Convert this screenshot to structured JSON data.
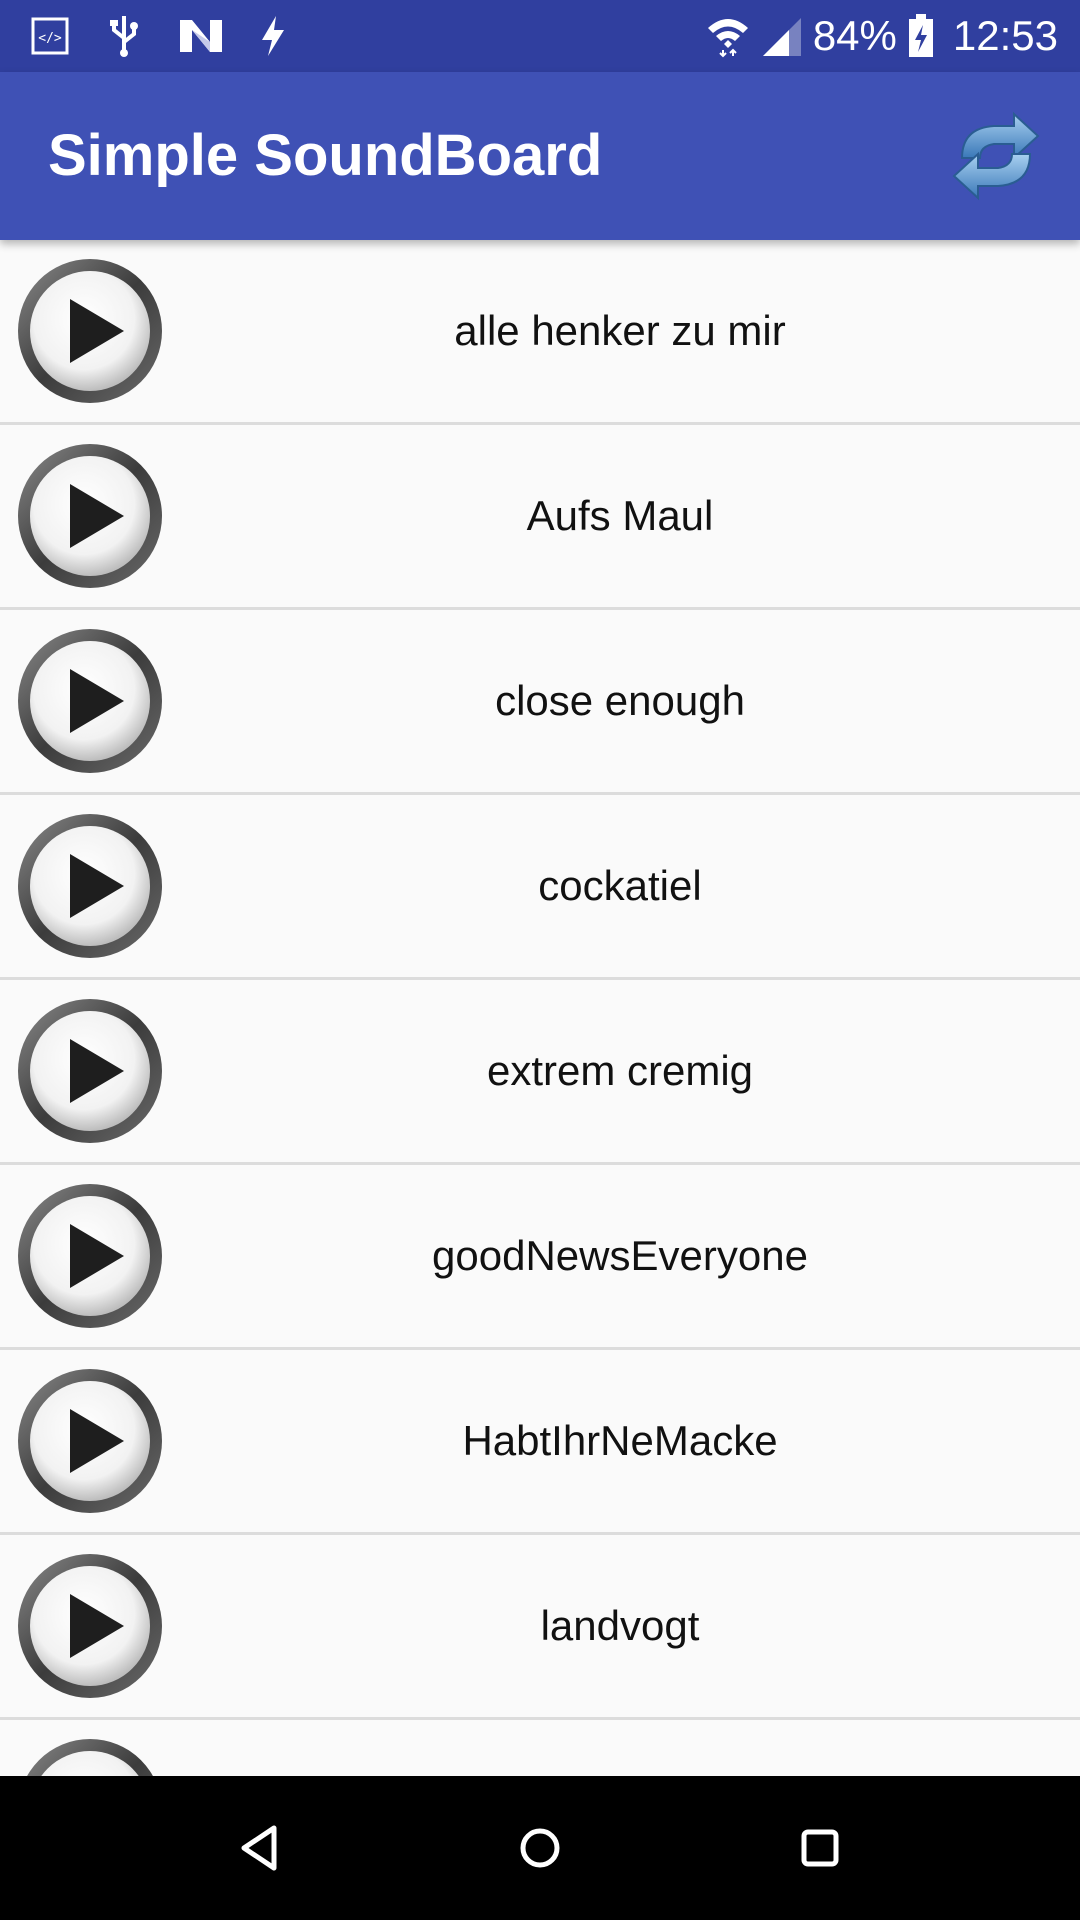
{
  "status_bar": {
    "battery_percent": "84%",
    "time": "12:53",
    "icons": [
      "code-icon",
      "usb-icon",
      "n-icon",
      "flash-icon",
      "wifi-icon",
      "signal-icon",
      "battery-charging-icon"
    ]
  },
  "app_bar": {
    "title": "Simple SoundBoard",
    "refresh_icon": "refresh-icon"
  },
  "sounds": [
    {
      "label": "alle henker zu mir"
    },
    {
      "label": "Aufs Maul"
    },
    {
      "label": "close enough"
    },
    {
      "label": "cockatiel"
    },
    {
      "label": "extrem cremig"
    },
    {
      "label": "goodNewsEveryone"
    },
    {
      "label": "HabtIhrNeMacke"
    },
    {
      "label": "landvogt"
    },
    {
      "label": ""
    }
  ],
  "nav_bar": {
    "icons": [
      "back-icon",
      "home-icon",
      "recents-icon"
    ]
  },
  "colors": {
    "status_bar": "#303f9f",
    "app_bar": "#3f51b5",
    "list_bg": "#fafafa",
    "nav_bar": "#000000"
  }
}
